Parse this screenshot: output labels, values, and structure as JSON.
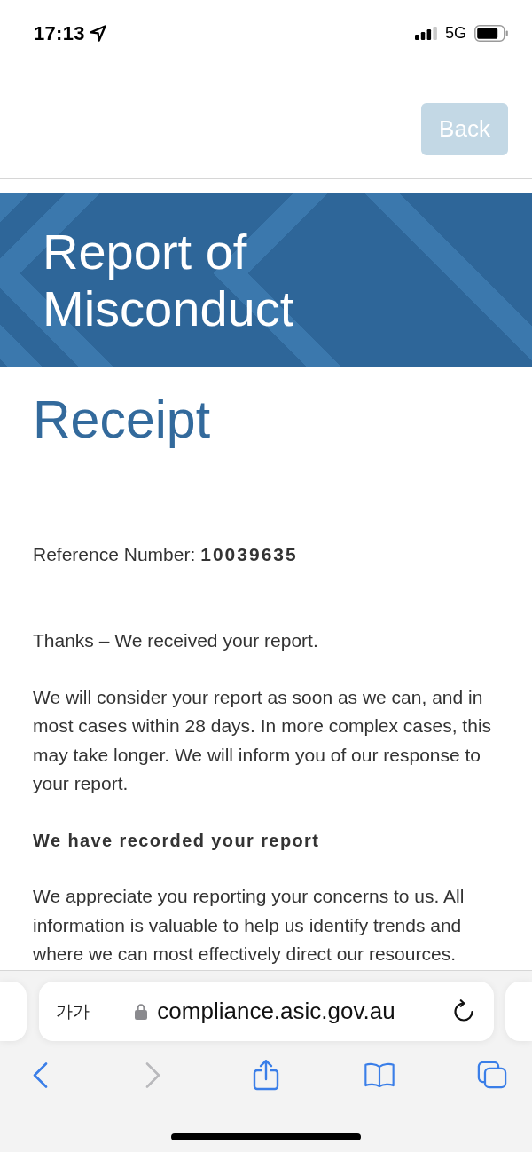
{
  "status_bar": {
    "time": "17:13",
    "network": "5G"
  },
  "header": {
    "back_button": "Back"
  },
  "banner": {
    "title": "Report of Misconduct"
  },
  "page": {
    "heading": "Receipt",
    "reference": {
      "label": "Reference Number:",
      "value": "10039635"
    },
    "blocks": [
      {
        "kind": "paragraph",
        "text": "Thanks – We received your report."
      },
      {
        "kind": "paragraph",
        "text": "We will consider your report as soon as we can, and in most cases within 28 days. In more complex cases, this may take longer. We will inform you of our response to your report."
      },
      {
        "kind": "heading",
        "text": "We have recorded your report"
      },
      {
        "kind": "paragraph",
        "text": "We appreciate you reporting your concerns to us. All information is valuable to help us identify trends and where we can most effectively direct our resources."
      }
    ]
  },
  "browser": {
    "text_size_button": "가가",
    "url": "compliance.asic.gov.au",
    "toolbar": [
      {
        "kind": "back",
        "disabled": false
      },
      {
        "kind": "forward",
        "disabled": true
      },
      {
        "kind": "share",
        "disabled": false
      },
      {
        "kind": "bookmarks",
        "disabled": false
      },
      {
        "kind": "tabs",
        "disabled": false
      }
    ]
  }
}
